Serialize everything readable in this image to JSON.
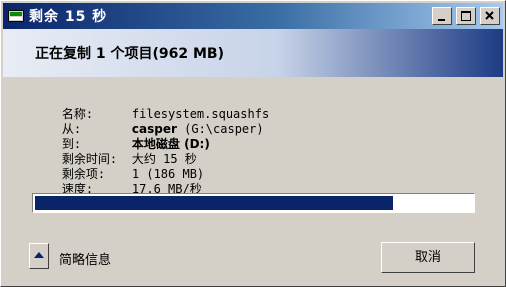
{
  "window": {
    "title": "剩余 15 秒",
    "controls": {
      "minimize": "minimize-icon",
      "maximize": "maximize-icon",
      "close": "close-icon"
    }
  },
  "header": {
    "text": "正在复制 1 个项目(962 MB)"
  },
  "details": {
    "name_label": "名称:",
    "name_value": "filesystem.squashfs",
    "from_label": "从:",
    "from_value_bold": "casper",
    "from_value_rest": " (G:\\casper)",
    "to_label": "到:",
    "to_value": "本地磁盘 (D:)",
    "time_left_label": "剩余时间:",
    "time_left_value": "大约 15 秒",
    "items_left_label": "剩余项:",
    "items_left_value": "1 (186 MB)",
    "speed_label": "速度:",
    "speed_value": "17.6 MB/秒"
  },
  "progress": {
    "fraction": 0.82,
    "color": "#0a246a"
  },
  "footer": {
    "more_info_label": "简略信息",
    "cancel_label": "取消"
  },
  "colors": {
    "title_bar": "#0a246a",
    "face": "#d4d0c8"
  }
}
